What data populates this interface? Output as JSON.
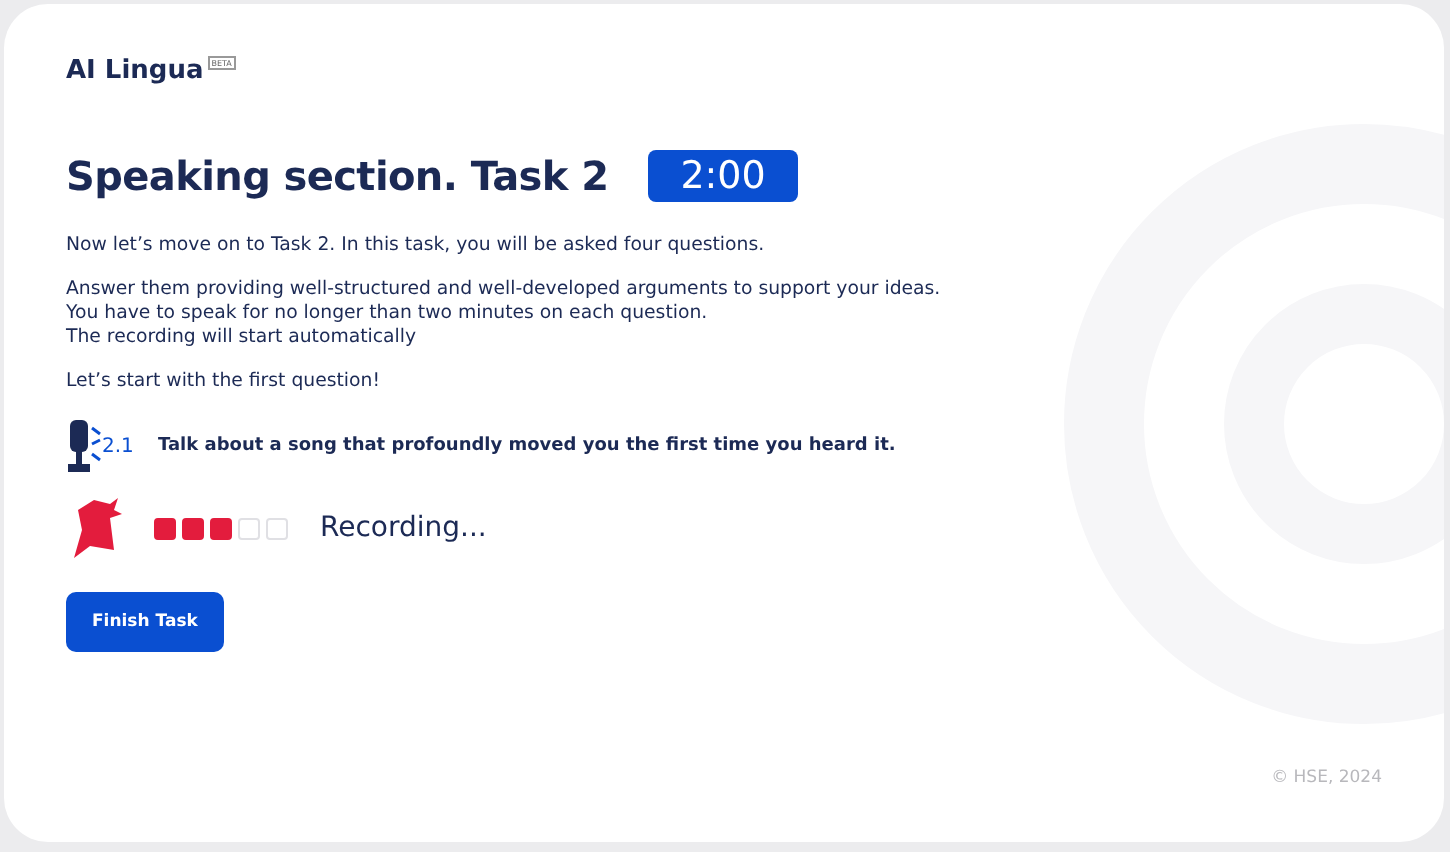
{
  "brand": {
    "name": "AI Lingua",
    "badge": "BETA"
  },
  "title": "Speaking section. Task 2",
  "timer": "2:00",
  "paragraphs": [
    "Now let’s move on to Task 2. In this task, you will be asked four questions.",
    "Answer them providing well-structured and well-developed arguments to support your ideas.\nYou have to speak for no longer than two minutes on each question.\nThe recording will start automatically",
    "Let’s start with the first question!"
  ],
  "question": {
    "number": "2.1",
    "text": "Talk about a song that profoundly moved you the first time you heard it."
  },
  "recorder": {
    "segments": [
      {
        "on": true
      },
      {
        "on": true
      },
      {
        "on": true
      },
      {
        "on": false
      },
      {
        "on": false
      }
    ],
    "status": "Recording..."
  },
  "finish_button": "Finish Task",
  "footer": "© HSE, 2024"
}
